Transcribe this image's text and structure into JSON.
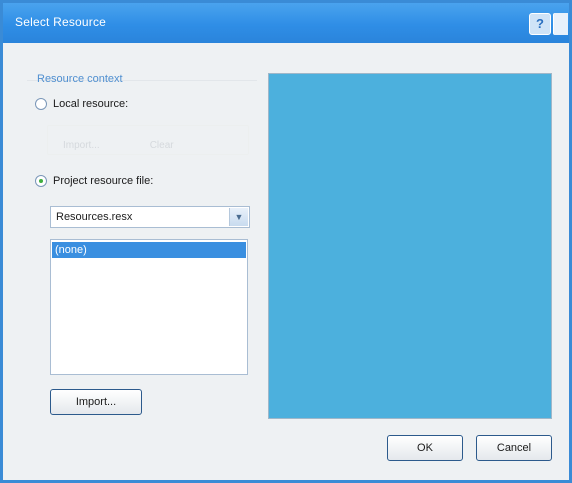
{
  "window": {
    "title": "Select Resource"
  },
  "resource_context": {
    "label": "Resource context",
    "local": {
      "label": "Local resource:",
      "selected": false
    },
    "faded_buttons": [
      "Import...",
      "Clear"
    ],
    "project": {
      "label": "Project resource file:",
      "selected": true
    }
  },
  "combo": {
    "value": "Resources.resx"
  },
  "list": {
    "selected_item": "(none)"
  },
  "import_label": "Import...",
  "ok_label": "OK",
  "cancel_label": "Cancel",
  "help_glyph": "?",
  "accent": "#2f8ee6",
  "preview_color": "#4cb0dd"
}
